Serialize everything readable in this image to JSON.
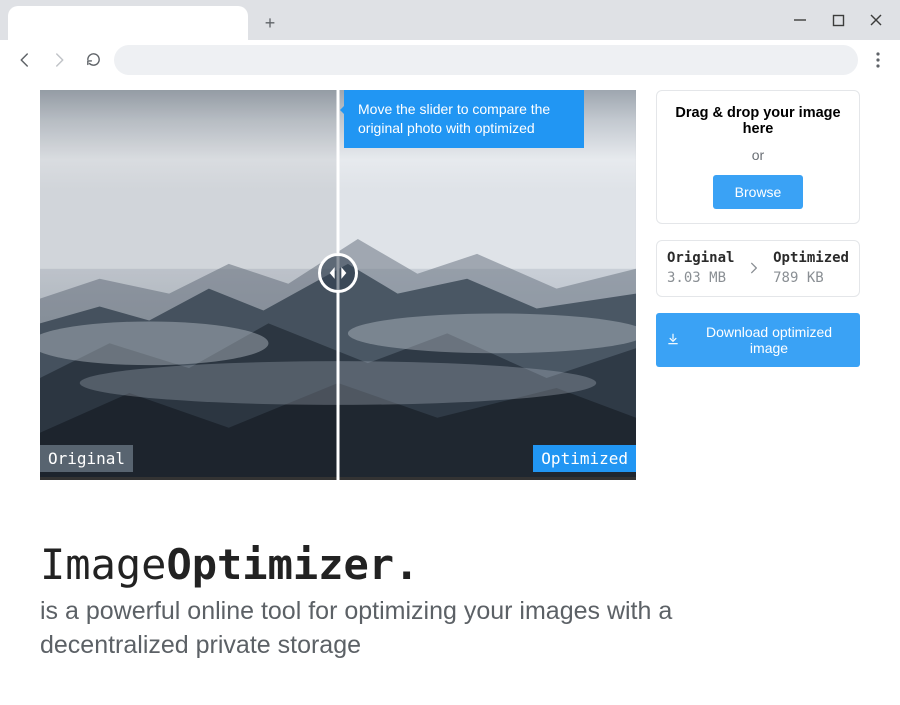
{
  "tooltip": "Move the slider to compare the original photo with optimized",
  "labels": {
    "original": "Original",
    "optimized": "Optimized"
  },
  "drop": {
    "title": "Drag & drop your image here",
    "or": "or",
    "browse": "Browse"
  },
  "sizes": {
    "original_label": "Original",
    "original_value": "3.03 MB",
    "optimized_label": "Optimized",
    "optimized_value": "789 KB"
  },
  "download": "Download optimized image",
  "brand": {
    "a": "Image",
    "b": "Optimizer",
    "dot": "."
  },
  "tagline": "is a powerful online tool for optimizing your images with a decentralized private storage"
}
